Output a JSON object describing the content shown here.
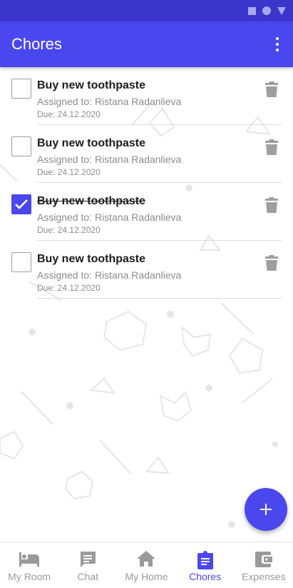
{
  "app": {
    "title": "Chores",
    "overflow_icon": "more-vert-icon"
  },
  "colors": {
    "primary": "#4b47ee",
    "status_bar": "#3a36cc",
    "inactive": "#9a9a9a",
    "text": "#1c1c1c"
  },
  "chores": [
    {
      "title": "Buy new toothpaste",
      "assigned": "Assigned to: Ristana Radanlieva",
      "due": "Due: 24.12.2020",
      "checked": false
    },
    {
      "title": "Buy new toothpaste",
      "assigned": "Assigned to: Ristana Radanlieva",
      "due": "Due: 24.12.2020",
      "checked": false
    },
    {
      "title": "Buy new toothpaste",
      "assigned": "Assigned to: Ristana Radanlieva",
      "due": "Due: 24.12.2020",
      "checked": true
    },
    {
      "title": "Buy new toothpaste",
      "assigned": "Assigned to: Ristana Radanlieva",
      "due": "Due: 24.12.2020",
      "checked": false
    }
  ],
  "fab": {
    "icon": "add-icon"
  },
  "nav": {
    "active": "Chores",
    "items": [
      {
        "label": "My Room",
        "icon": "bed-icon"
      },
      {
        "label": "Chat",
        "icon": "chat-icon"
      },
      {
        "label": "My Home",
        "icon": "home-icon"
      },
      {
        "label": "Chores",
        "icon": "assignment-icon"
      },
      {
        "label": "Expenses",
        "icon": "wallet-icon"
      }
    ]
  }
}
